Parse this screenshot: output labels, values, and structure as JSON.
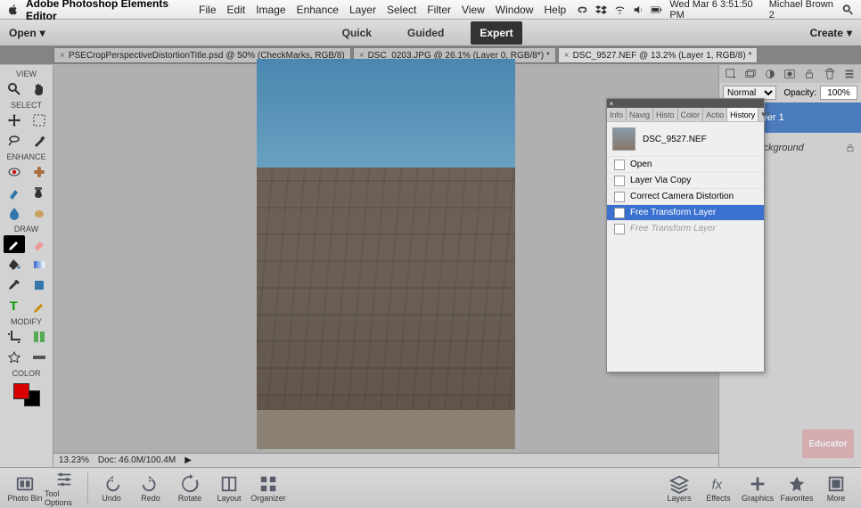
{
  "menubar": {
    "app_name": "Adobe Photoshop Elements Editor",
    "items": [
      "File",
      "Edit",
      "Image",
      "Enhance",
      "Layer",
      "Select",
      "Filter",
      "View",
      "Window",
      "Help"
    ],
    "clock": "Wed Mar 6  3:51:50 PM",
    "user": "Michael Brown 2"
  },
  "appbar": {
    "open": "Open",
    "modes": {
      "quick": "Quick",
      "guided": "Guided",
      "expert": "Expert"
    },
    "create": "Create"
  },
  "toolstrip": {
    "sections": {
      "view": "VIEW",
      "select": "SELECT",
      "enhance": "ENHANCE",
      "draw": "DRAW",
      "modify": "MODIFY",
      "color": "COLOR"
    }
  },
  "tabs": [
    {
      "label": "PSECropPerspectiveDistortionTitle.psd @ 50% (CheckMarks, RGB/8)"
    },
    {
      "label": "DSC_0203.JPG @ 26.1% (Layer 0, RGB/8*) *"
    },
    {
      "label": "DSC_9527.NEF @ 13.2% (Layer 1, RGB/8) *"
    }
  ],
  "status": {
    "zoom": "13.23%",
    "doc": "Doc: 46.0M/100.4M"
  },
  "layerspanel": {
    "blendmode": "Normal",
    "opacity_label": "Opacity:",
    "opacity_value": "100%",
    "layer1": "Layer 1",
    "background": "Background"
  },
  "historypanel": {
    "tabs": [
      "Info",
      "Navig",
      "Histo",
      "Color",
      "Actio",
      "History"
    ],
    "file": "DSC_9527.NEF",
    "items": [
      {
        "label": "Open"
      },
      {
        "label": "Layer Via Copy"
      },
      {
        "label": "Correct Camera Distortion"
      },
      {
        "label": "Free Transform Layer"
      },
      {
        "label": "Free Transform Layer"
      }
    ]
  },
  "bottombar": {
    "left": [
      "Photo Bin",
      "Tool Options",
      "Undo",
      "Redo",
      "Rotate",
      "Layout",
      "Organizer"
    ],
    "right": [
      "Layers",
      "Effects",
      "Graphics",
      "Favorites",
      "More"
    ]
  },
  "watermark": "Educator"
}
